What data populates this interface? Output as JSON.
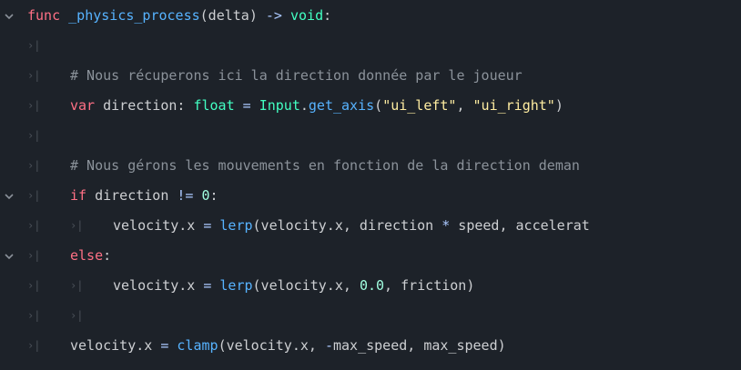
{
  "lines": [
    {
      "tokens": [
        [
          "kw",
          "func"
        ],
        [
          "txt",
          " "
        ],
        [
          "fn",
          "_physics_process"
        ],
        [
          "txt",
          "(delta) "
        ],
        [
          "op",
          "->"
        ],
        [
          "txt",
          " "
        ],
        [
          "ty",
          "void"
        ],
        [
          "txt",
          ":"
        ]
      ]
    },
    {
      "tokens": []
    },
    {
      "tokens": [
        [
          "com",
          "# Nous récuperons ici la direction donnée par le joueur"
        ]
      ]
    },
    {
      "tokens": [
        [
          "kw",
          "var"
        ],
        [
          "txt",
          " direction: "
        ],
        [
          "ty",
          "float"
        ],
        [
          "txt",
          " "
        ],
        [
          "op",
          "="
        ],
        [
          "txt",
          " "
        ],
        [
          "ty",
          "Input"
        ],
        [
          "txt",
          "."
        ],
        [
          "fn",
          "get_axis"
        ],
        [
          "txt",
          "("
        ],
        [
          "str",
          "\"ui_left\""
        ],
        [
          "txt",
          ", "
        ],
        [
          "str",
          "\"ui_right\""
        ],
        [
          "txt",
          ")"
        ]
      ]
    },
    {
      "tokens": []
    },
    {
      "tokens": [
        [
          "com",
          "# Nous gérons les mouvements en fonction de la direction deman"
        ]
      ]
    },
    {
      "tokens": [
        [
          "kw",
          "if"
        ],
        [
          "txt",
          " direction "
        ],
        [
          "op",
          "!="
        ],
        [
          "txt",
          " "
        ],
        [
          "num",
          "0"
        ],
        [
          "txt",
          ":"
        ]
      ]
    },
    {
      "tokens": [
        [
          "txt",
          "velocity.x "
        ],
        [
          "op",
          "="
        ],
        [
          "txt",
          " "
        ],
        [
          "fn",
          "lerp"
        ],
        [
          "txt",
          "(velocity.x, direction "
        ],
        [
          "op",
          "*"
        ],
        [
          "txt",
          " speed, accelerat"
        ]
      ]
    },
    {
      "tokens": [
        [
          "kw",
          "else"
        ],
        [
          "txt",
          ":"
        ]
      ]
    },
    {
      "tokens": [
        [
          "txt",
          "velocity.x "
        ],
        [
          "op",
          "="
        ],
        [
          "txt",
          " "
        ],
        [
          "fn",
          "lerp"
        ],
        [
          "txt",
          "(velocity.x, "
        ],
        [
          "num",
          "0.0"
        ],
        [
          "txt",
          ", friction)"
        ]
      ]
    },
    {
      "tokens": []
    },
    {
      "tokens": [
        [
          "txt",
          "velocity.x "
        ],
        [
          "op",
          "="
        ],
        [
          "txt",
          " "
        ],
        [
          "fn",
          "clamp"
        ],
        [
          "txt",
          "(velocity.x, "
        ],
        [
          "op",
          "-"
        ],
        [
          "txt",
          "max_speed, max_speed)"
        ]
      ]
    }
  ],
  "tab_glyph": "›|",
  "colors": {
    "background": "#1d2229",
    "keyword": "#ff7085",
    "function": "#57b3ff",
    "type": "#42ffc2",
    "string": "#ffeda1",
    "number": "#a1ffe0",
    "comment": "#8b929a",
    "text": "#cdcfd2"
  }
}
